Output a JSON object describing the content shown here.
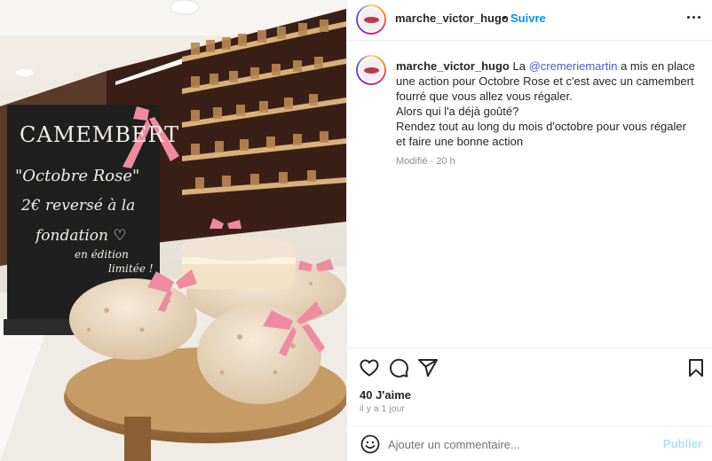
{
  "photo": {
    "alt": "Camembert Octobre Rose",
    "board": {
      "line1": "CAMEMBERT",
      "line2": "\"Octobre Rose\"",
      "line3": "2€ reversé à la",
      "line4": "fondation ♡",
      "line5": "en édition",
      "line6": "limitée !"
    }
  },
  "header": {
    "username": "marche_victor_hugo",
    "separator": "•",
    "follow_label": "Suivre",
    "more_icon": "more-horizontal-icon"
  },
  "post": {
    "username": "marche_victor_hugo",
    "text_before": " La ",
    "mention": "@cremeriemartin",
    "text_after": " a mis en place une action pour Octobre Rose et c'est avec un camembert fourré que vous allez vous régaler.",
    "line2": "Alors qui l'a déjà goûté?",
    "line3": "Rendez tout au long du mois d'octobre pour vous régaler et faire une bonne action",
    "edited": "Modifié",
    "meta_sep": " · ",
    "time": "20 h"
  },
  "actions": {
    "icons": [
      "heart-icon",
      "comment-icon",
      "share-icon",
      "bookmark-icon"
    ],
    "likes": "40 J'aime",
    "date": "il y a 1 jour"
  },
  "comment": {
    "emoji_icon": "emoji-icon",
    "placeholder": "Ajouter un commentaire...",
    "publish_label": "Publier"
  },
  "colors": {
    "link": "#0095f6",
    "mention": "#4a5bd6",
    "publish_disabled": "#b2dffc",
    "ribbon": "#f08aa0",
    "logo": "#b53b4d"
  }
}
